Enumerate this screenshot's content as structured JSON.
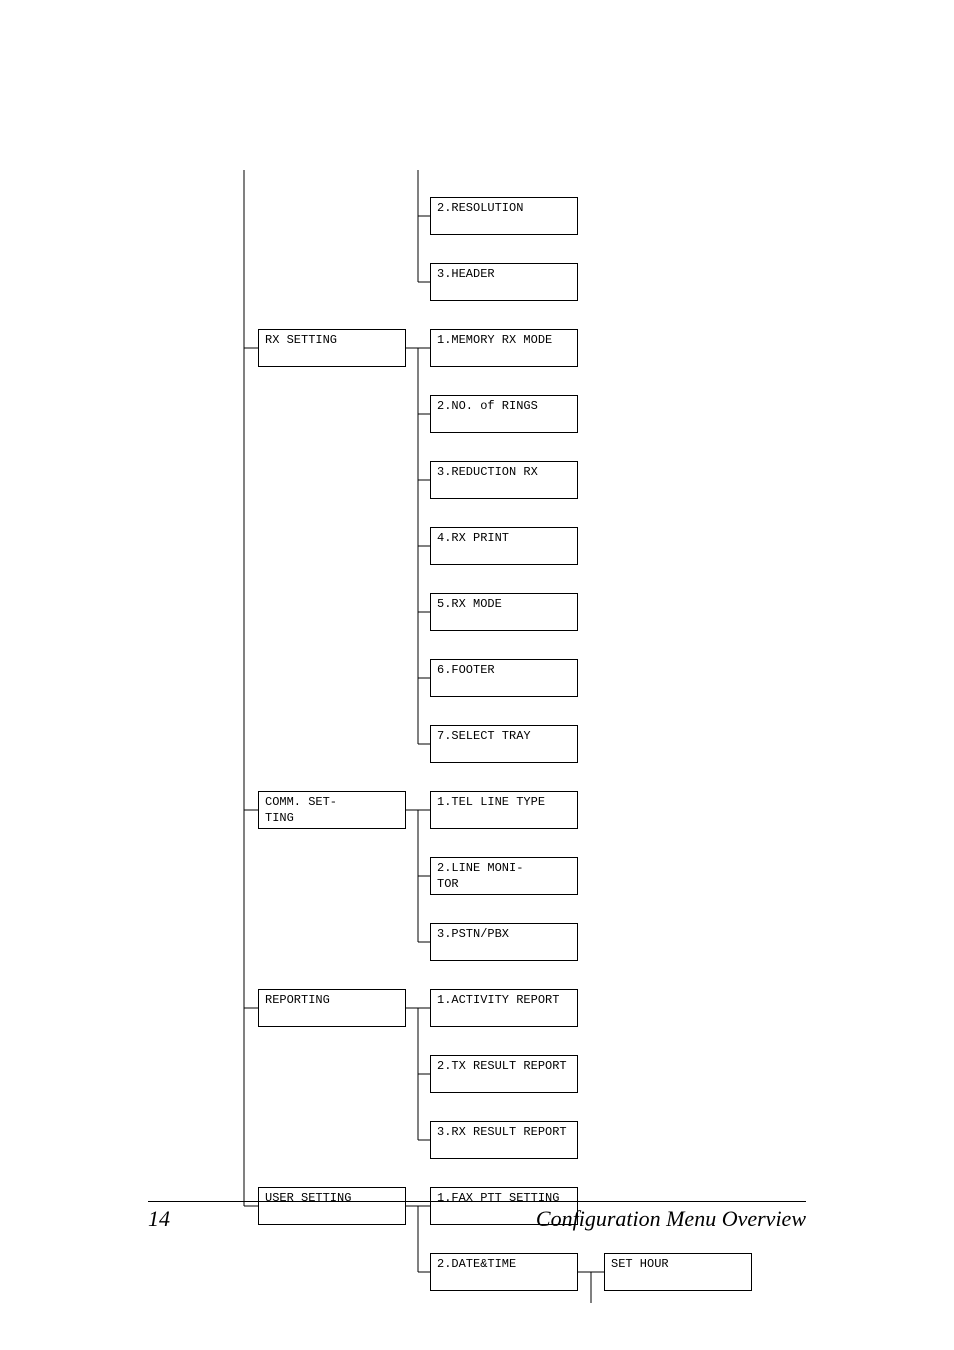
{
  "columns": {
    "parent": [
      "RX SETTING",
      "COMM. SET-\nTING",
      "REPORTING",
      "USER SETTING"
    ],
    "child_groups": [
      [
        "2.RESOLUTION",
        "3.HEADER"
      ],
      [
        "1.MEMORY RX MODE",
        "2.NO. of RINGS",
        "3.REDUCTION RX",
        "4.RX PRINT",
        "5.RX MODE",
        "6.FOOTER",
        "7.SELECT TRAY"
      ],
      [
        "1.TEL LINE TYPE",
        "2.LINE MONI-\nTOR",
        "3.PSTN/PBX"
      ],
      [
        "1.ACTIVITY REPORT",
        "2.TX RESULT REPORT",
        "3.RX RESULT REPORT"
      ],
      [
        "1.FAX PTT SETTING",
        "2.DATE&TIME"
      ]
    ],
    "level3": [
      "SET HOUR"
    ]
  },
  "footer": {
    "page": "14",
    "title": "Configuration Menu Overview"
  }
}
